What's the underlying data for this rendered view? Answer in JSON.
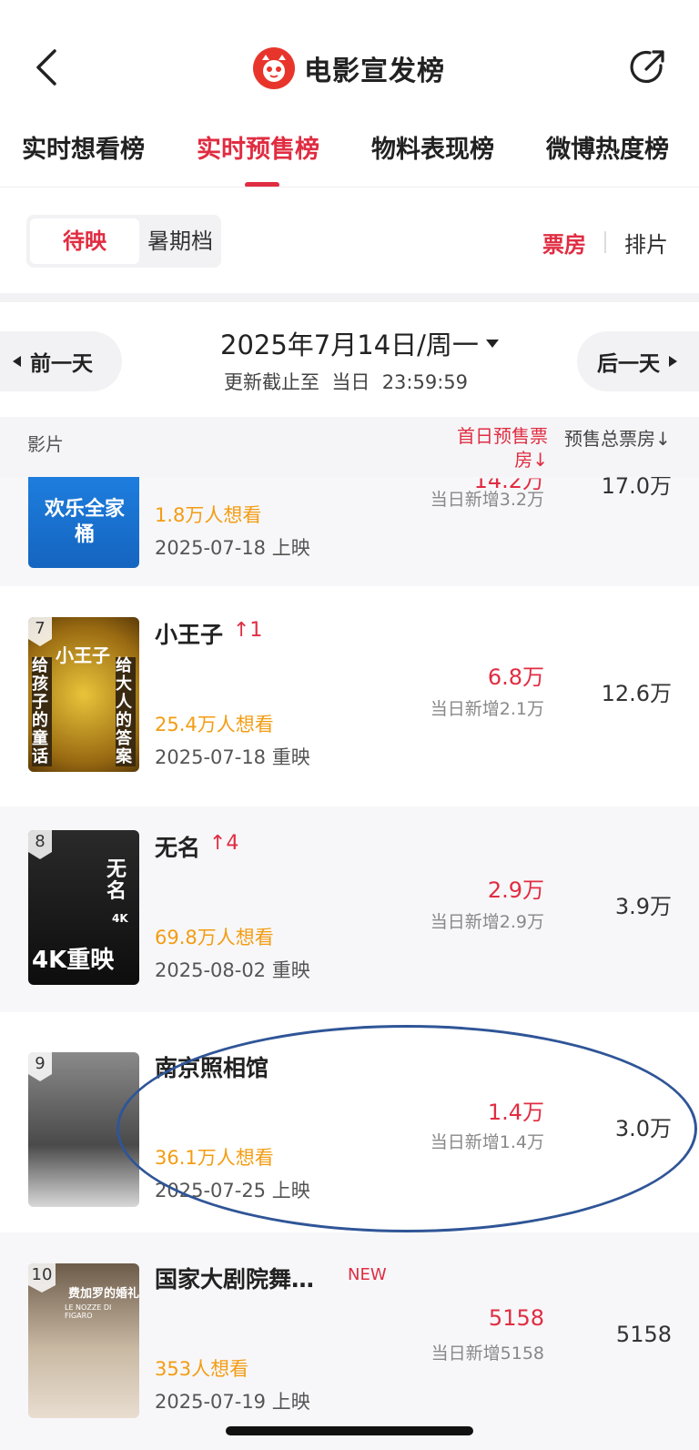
{
  "header": {
    "title": "电影宣发榜"
  },
  "tabs": [
    {
      "label": "实时想看榜"
    },
    {
      "label": "实时预售榜"
    },
    {
      "label": "物料表现榜"
    },
    {
      "label": "微博热度榜"
    }
  ],
  "segment": {
    "active": "待映",
    "inactive": "暑期档"
  },
  "metric_toggle": {
    "active": "票房",
    "inactive": "排片"
  },
  "date_nav": {
    "prev": "前一天",
    "next": "后一天",
    "date": "2025年7月14日/周一",
    "updated": "更新截止至  当日  23:59:59"
  },
  "columns": {
    "film": "影片",
    "first_day": "首日预售票房",
    "total": "预售总票房"
  },
  "partial_row": {
    "poster_text": "欢乐全家桶",
    "want": "1.8万人想看",
    "release": "2025-07-18 上映",
    "first_value": "14.2万",
    "daily_add": "当日新增3.2万",
    "total": "17.0万"
  },
  "rows": [
    {
      "rank": "7",
      "name": "小王子",
      "change": "↑1",
      "want": "25.4万人想看",
      "release": "2025-07-18 重映",
      "first_value": "6.8万",
      "daily_add": "当日新增2.1万",
      "total": "12.6万",
      "poster_title": "小王子",
      "poster_left": "给孩子的童话",
      "poster_right": "给大人的答案"
    },
    {
      "rank": "8",
      "name": "无名",
      "change": "↑4",
      "want": "69.8万人想看",
      "release": "2025-08-02 重映",
      "first_value": "2.9万",
      "daily_add": "当日新增2.9万",
      "total": "3.9万",
      "poster_title": "无名",
      "poster_sub": "4K重映",
      "poster_badge": "4K"
    },
    {
      "rank": "9",
      "name": "南京照相馆",
      "change": "",
      "want": "36.1万人想看",
      "release": "2025-07-25 上映",
      "first_value": "1.4万",
      "daily_add": "当日新增1.4万",
      "total": "3.0万"
    },
    {
      "rank": "10",
      "name": "国家大剧院舞…",
      "badge": "NEW",
      "want": "353人想看",
      "release": "2025-07-19 上映",
      "first_value": "5158",
      "daily_add": "当日新增5158",
      "total": "5158",
      "poster_title": "费加罗的婚礼",
      "poster_sub": "LE NOZZE DI FIGARO"
    }
  ],
  "colors": {
    "accent": "#e02d42",
    "want": "#f39c12",
    "highlight": "#2f5597"
  }
}
